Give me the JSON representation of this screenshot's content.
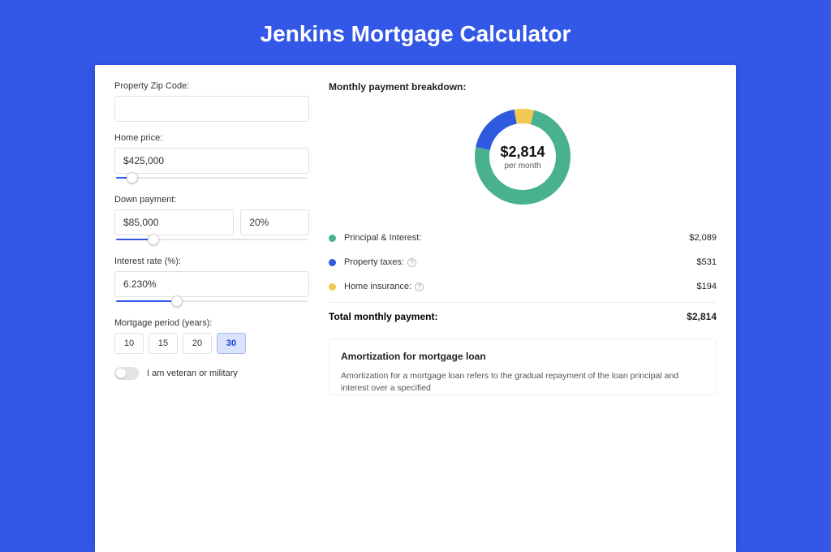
{
  "title": "Jenkins Mortgage Calculator",
  "colors": {
    "principal": "#49b190",
    "taxes": "#2e5adf",
    "insurance": "#f0c852"
  },
  "form": {
    "zip_label": "Property Zip Code:",
    "zip_value": "",
    "home_price_label": "Home price:",
    "home_price_value": "$425,000",
    "home_price_slider_pct": 9,
    "down_payment_label": "Down payment:",
    "down_payment_value": "$85,000",
    "down_payment_pct_value": "20%",
    "down_payment_slider_pct": 20,
    "interest_label": "Interest rate (%):",
    "interest_value": "6.230%",
    "interest_slider_pct": 32,
    "period_label": "Mortgage period (years):",
    "periods": [
      {
        "label": "10",
        "active": false
      },
      {
        "label": "15",
        "active": false
      },
      {
        "label": "20",
        "active": false
      },
      {
        "label": "30",
        "active": true
      }
    ],
    "veteran_label": "I am veteran or military",
    "veteran_on": false
  },
  "breakdown": {
    "title": "Monthly payment breakdown:",
    "center_amount": "$2,814",
    "center_sub": "per month",
    "items": [
      {
        "key": "principal",
        "label": "Principal & Interest:",
        "amount": "$2,089",
        "help": false,
        "value": 2089
      },
      {
        "key": "taxes",
        "label": "Property taxes:",
        "amount": "$531",
        "help": true,
        "value": 531
      },
      {
        "key": "insurance",
        "label": "Home insurance:",
        "amount": "$194",
        "help": true,
        "value": 194
      }
    ],
    "total_label": "Total monthly payment:",
    "total_amount": "$2,814",
    "total_value": 2814
  },
  "amortization": {
    "title": "Amortization for mortgage loan",
    "body": "Amortization for a mortgage loan refers to the gradual repayment of the loan principal and interest over a specified"
  },
  "chart_data": {
    "type": "pie",
    "title": "Monthly payment breakdown:",
    "series": [
      {
        "name": "Principal & Interest",
        "value": 2089,
        "color": "#49b190"
      },
      {
        "name": "Property taxes",
        "value": 531,
        "color": "#2e5adf"
      },
      {
        "name": "Home insurance",
        "value": 194,
        "color": "#f0c852"
      }
    ],
    "total": 2814,
    "center_label": "$2,814 per month"
  }
}
